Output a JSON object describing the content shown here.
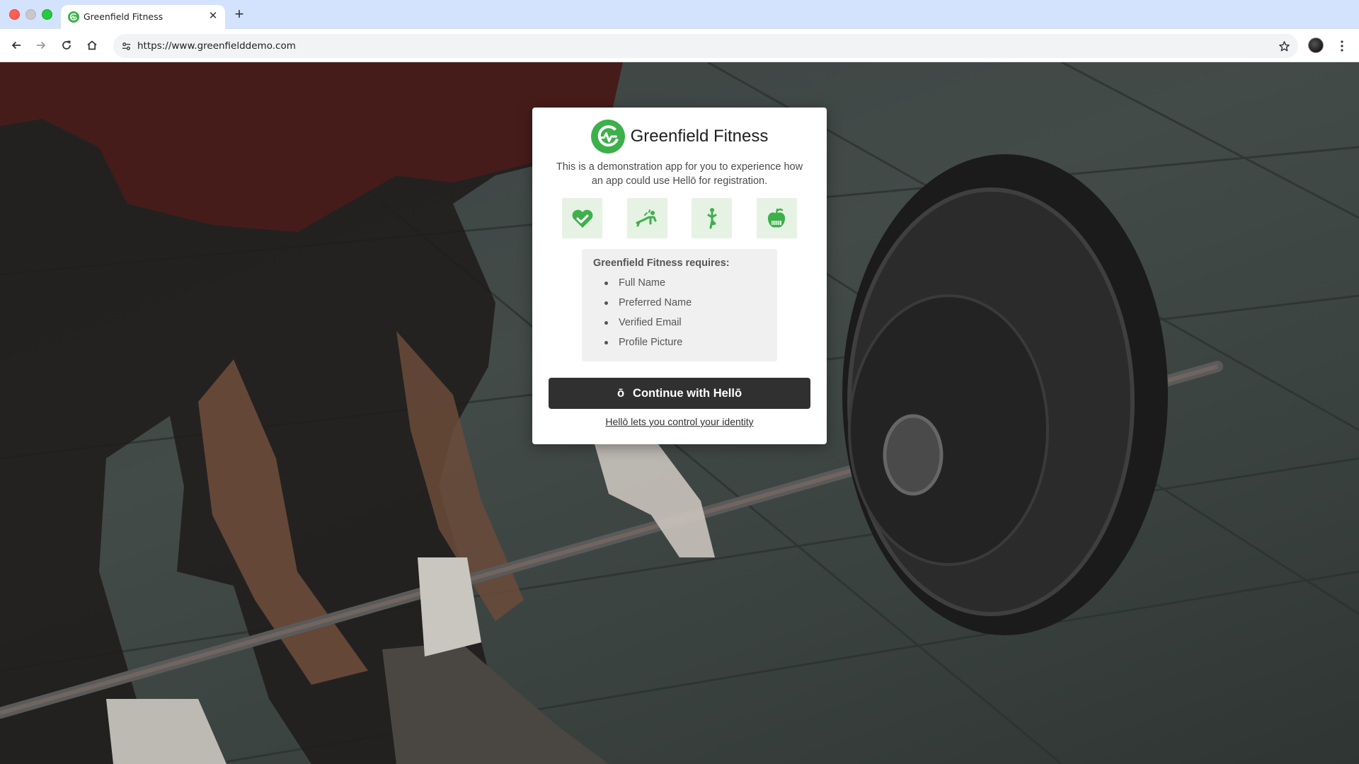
{
  "browser": {
    "tab_title": "Greenfield Fitness",
    "tab_close_icon": "close-icon",
    "new_tab_icon": "plus-icon",
    "url": "https://www.greenfielddemo.com",
    "nav_icons": [
      "back-arrow-icon",
      "forward-arrow-icon",
      "reload-icon",
      "home-icon"
    ],
    "site_info_icon": "tune-icon",
    "bookmark_icon": "star-icon",
    "menu_icon": "vertical-dots-icon"
  },
  "card": {
    "brand_name": "Greenfield Fitness",
    "intro": "This is a demonstration app for you to experience how an app could use Hellō for registration.",
    "feature_icons": [
      "heart-check-icon",
      "pushup-icon",
      "yoga-icon",
      "apple-icon"
    ],
    "requirements_title": "Greenfield Fitness requires:",
    "requirements": [
      "Full Name",
      "Preferred Name",
      "Verified Email",
      "Profile Picture"
    ],
    "continue_logo": "ō",
    "continue_label": "Continue with Hellō",
    "identity_link": "Hellō lets you control your identity"
  },
  "colors": {
    "brand_green": "#3db04b",
    "tile_bg": "#e6f2e3",
    "button_bg": "#303030",
    "tabbar_bg": "#d3e3fd"
  }
}
